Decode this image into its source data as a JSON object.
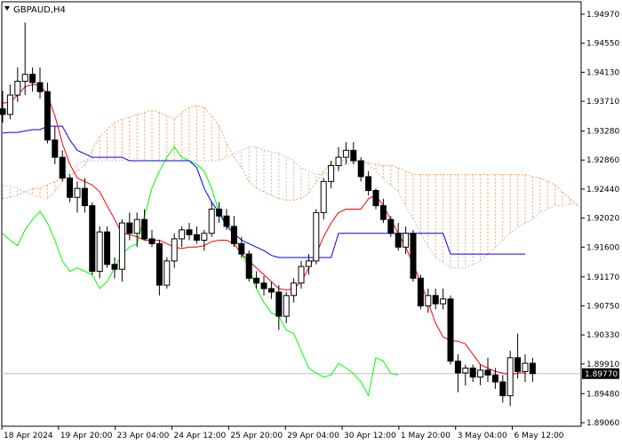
{
  "chart_data": {
    "type": "candlestick",
    "title": "GBPAUD,H4",
    "y_ticks": [
      "1.94970",
      "1.94550",
      "1.94130",
      "1.93710",
      "1.93280",
      "1.92860",
      "1.92440",
      "1.92020",
      "1.91600",
      "1.91170",
      "1.90750",
      "1.90330",
      "1.89910",
      "1.89480",
      "1.89060"
    ],
    "ylim": [
      1.8906,
      1.9497
    ],
    "x_ticks": [
      "18 Apr 2024",
      "19 Apr 20:00",
      "23 Apr 04:00",
      "24 Apr 12:00",
      "25 Apr 20:00",
      "29 Apr 04:00",
      "30 Apr 12:00",
      "1 May 20:00",
      "3 May 04:00",
      "6 May 12:00"
    ],
    "current_price": "1.89770",
    "grid": false,
    "colors": {
      "tenkan": "#ff0000",
      "kijun": "#0000ff",
      "chikou": "#00ff00",
      "cloud": "#f4a460",
      "cloud_alt": "#c0c0c0",
      "candle": "#000000",
      "price_line": "#c0c0c0"
    },
    "candles": [
      [
        1.936,
        1.9386,
        1.934,
        1.9352
      ],
      [
        1.9352,
        1.9395,
        1.9345,
        1.938
      ],
      [
        1.938,
        1.942,
        1.937,
        1.94
      ],
      [
        1.94,
        1.9485,
        1.938,
        1.941
      ],
      [
        1.941,
        1.942,
        1.9385,
        1.9398
      ],
      [
        1.9398,
        1.942,
        1.9375,
        1.9385
      ],
      [
        1.9385,
        1.9398,
        1.931,
        1.9315
      ],
      [
        1.9315,
        1.9335,
        1.928,
        1.929
      ],
      [
        1.929,
        1.93,
        1.9255,
        1.926
      ],
      [
        1.926,
        1.9265,
        1.9225,
        1.9232
      ],
      [
        1.9232,
        1.9255,
        1.921,
        1.9245
      ],
      [
        1.9245,
        1.926,
        1.921,
        1.922
      ],
      [
        1.922,
        1.9225,
        1.912,
        1.9125
      ],
      [
        1.9125,
        1.919,
        1.9115,
        1.9182
      ],
      [
        1.9182,
        1.919,
        1.913,
        1.9135
      ],
      [
        1.9135,
        1.9145,
        1.9115,
        1.9128
      ],
      [
        1.9128,
        1.92,
        1.911,
        1.9195
      ],
      [
        1.9195,
        1.921,
        1.917,
        1.918
      ],
      [
        1.918,
        1.921,
        1.916,
        1.92
      ],
      [
        1.92,
        1.9215,
        1.917,
        1.9172
      ],
      [
        1.9172,
        1.9185,
        1.916,
        1.9165
      ],
      [
        1.9165,
        1.917,
        1.909,
        1.9105
      ],
      [
        1.9105,
        1.9145,
        1.91,
        1.914
      ],
      [
        1.914,
        1.918,
        1.913,
        1.9172
      ],
      [
        1.9172,
        1.919,
        1.916,
        1.9185
      ],
      [
        1.9185,
        1.9195,
        1.917,
        1.9178
      ],
      [
        1.9178,
        1.919,
        1.9165,
        1.917
      ],
      [
        1.917,
        1.9185,
        1.9155,
        1.918
      ],
      [
        1.918,
        1.9225,
        1.9175,
        1.9215
      ],
      [
        1.9215,
        1.9225,
        1.9195,
        1.9205
      ],
      [
        1.9205,
        1.9215,
        1.9185,
        1.919
      ],
      [
        1.919,
        1.9205,
        1.916,
        1.9165
      ],
      [
        1.9165,
        1.9175,
        1.9145,
        1.915
      ],
      [
        1.915,
        1.9155,
        1.911,
        1.9115
      ],
      [
        1.9115,
        1.9125,
        1.91,
        1.9108
      ],
      [
        1.9108,
        1.9118,
        1.909,
        1.91
      ],
      [
        1.91,
        1.911,
        1.9085,
        1.9095
      ],
      [
        1.9095,
        1.9105,
        1.904,
        1.906
      ],
      [
        1.906,
        1.9095,
        1.905,
        1.909
      ],
      [
        1.909,
        1.9115,
        1.908,
        1.9108
      ],
      [
        1.9108,
        1.914,
        1.91,
        1.9132
      ],
      [
        1.9132,
        1.915,
        1.912,
        1.914
      ],
      [
        1.914,
        1.9215,
        1.9135,
        1.921
      ],
      [
        1.921,
        1.926,
        1.92,
        1.9255
      ],
      [
        1.9255,
        1.9285,
        1.9245,
        1.9278
      ],
      [
        1.9278,
        1.9305,
        1.927,
        1.929
      ],
      [
        1.929,
        1.9312,
        1.928,
        1.93
      ],
      [
        1.93,
        1.9312,
        1.928,
        1.9285
      ],
      [
        1.9285,
        1.929,
        1.9255,
        1.9262
      ],
      [
        1.9262,
        1.927,
        1.9235,
        1.9242
      ],
      [
        1.9242,
        1.9245,
        1.9215,
        1.922
      ],
      [
        1.922,
        1.923,
        1.9195,
        1.92
      ],
      [
        1.92,
        1.9205,
        1.9175,
        1.918
      ],
      [
        1.918,
        1.9195,
        1.9155,
        1.916
      ],
      [
        1.916,
        1.919,
        1.915,
        1.918
      ],
      [
        1.918,
        1.9185,
        1.911,
        1.9115
      ],
      [
        1.9115,
        1.912,
        1.907,
        1.9075
      ],
      [
        1.9075,
        1.91,
        1.9065,
        1.909
      ],
      [
        1.909,
        1.91,
        1.907,
        1.9078
      ],
      [
        1.9078,
        1.91,
        1.907,
        1.9085
      ],
      [
        1.9085,
        1.909,
        1.899,
        1.8995
      ],
      [
        1.8995,
        1.9005,
        1.895,
        1.8978
      ],
      [
        1.8978,
        1.899,
        1.896,
        1.8985
      ],
      [
        1.8985,
        1.899,
        1.8965,
        1.8972
      ],
      [
        1.8972,
        1.899,
        1.896,
        1.8982
      ],
      [
        1.8982,
        1.9,
        1.8965,
        1.8975
      ],
      [
        1.8975,
        1.8985,
        1.8955,
        1.8965
      ],
      [
        1.8965,
        1.8975,
        1.8935,
        1.8945
      ],
      [
        1.8945,
        1.901,
        1.893,
        1.9
      ],
      [
        1.9,
        1.9035,
        1.897,
        1.898
      ],
      [
        1.898,
        1.9005,
        1.8965,
        1.8992
      ],
      [
        1.8992,
        1.9,
        1.8965,
        1.8977
      ]
    ],
    "tenkan": [
      1.9368,
      1.937,
      1.938,
      1.9392,
      1.9395,
      1.9395,
      1.938,
      1.935,
      1.931,
      1.928,
      1.926,
      1.9255,
      1.925,
      1.924,
      1.922,
      1.92,
      1.918,
      1.9178,
      1.9175,
      1.917,
      1.917,
      1.917,
      1.9165,
      1.916,
      1.9158,
      1.916,
      1.916,
      1.9162,
      1.9168,
      1.917,
      1.917,
      1.9165,
      1.915,
      1.914,
      1.913,
      1.912,
      1.911,
      1.91,
      1.9098,
      1.91,
      1.911,
      1.913,
      1.915,
      1.9175,
      1.9195,
      1.921,
      1.9215,
      1.9215,
      1.9215,
      1.923,
      1.9235,
      1.922,
      1.92,
      1.918,
      1.916,
      1.9135,
      1.911,
      1.908,
      1.905,
      1.903,
      1.9025,
      1.9024,
      1.902,
      1.9005,
      1.899,
      1.8985,
      1.898,
      1.8978,
      1.8975,
      1.8978,
      1.8978
    ],
    "kijun": [
      1.9325,
      1.9326,
      1.9326,
      1.9328,
      1.933,
      1.933,
      1.9335,
      1.9335,
      1.9335,
      1.9315,
      1.93,
      1.9295,
      1.929,
      1.929,
      1.929,
      1.929,
      1.929,
      1.9285,
      1.9285,
      1.9285,
      1.9285,
      1.9285,
      1.9285,
      1.9285,
      1.9285,
      1.9285,
      1.9275,
      1.9245,
      1.9225,
      1.921,
      1.919,
      1.918,
      1.917,
      1.9165,
      1.916,
      1.9155,
      1.9148,
      1.9145,
      1.9145,
      1.9145,
      1.9145,
      1.9145,
      1.9145,
      1.9145,
      1.9145,
      1.918,
      1.918,
      1.918,
      1.918,
      1.918,
      1.918,
      1.918,
      1.918,
      1.918,
      1.918,
      1.918,
      1.918,
      1.918,
      1.918,
      1.918,
      1.915,
      1.915,
      1.915,
      1.915,
      1.915,
      1.915,
      1.915,
      1.915,
      1.915,
      1.915,
      1.915
    ],
    "chikou": [
      1.918,
      1.917,
      1.9162,
      1.9185,
      1.92,
      1.9212,
      1.9195,
      1.917,
      1.914,
      1.9125,
      1.913,
      1.9125,
      1.912,
      1.91,
      1.911,
      1.913,
      1.915,
      1.916,
      1.9165,
      1.9205,
      1.9245,
      1.927,
      1.929,
      1.9305,
      1.929,
      1.9285,
      1.928,
      1.927,
      1.9245,
      1.921,
      1.9195,
      1.918,
      1.915,
      1.913,
      1.91,
      1.908,
      1.9065,
      1.906,
      1.904,
      1.9035,
      1.901,
      1.8985,
      1.8978,
      1.8972,
      1.8975,
      1.8992,
      1.8985,
      1.8977,
      1.8965,
      1.8945,
      1.9,
      1.8995,
      1.8977,
      1.8975
    ],
    "cloud_a": [
      1.923,
      1.9232,
      1.9235,
      1.924,
      1.9245,
      1.9245,
      1.925,
      1.9255,
      1.926,
      1.9265,
      1.927,
      1.9278,
      1.93,
      1.932,
      1.933,
      1.934,
      1.9345,
      1.9348,
      1.9352,
      1.9355,
      1.9358,
      1.9355,
      1.935,
      1.9345,
      1.9355,
      1.9362,
      1.9365,
      1.9362,
      1.935,
      1.9335,
      1.931,
      1.929,
      1.9275,
      1.9255,
      1.9245,
      1.924,
      1.9235,
      1.923,
      1.9228,
      1.9228,
      1.923,
      1.9238,
      1.9255,
      1.927,
      1.9282,
      1.9285,
      1.9285,
      1.9285,
      1.9285,
      1.9282,
      1.928,
      1.9278,
      1.9278,
      1.9275,
      1.927,
      1.9265,
      1.9265,
      1.9265,
      1.9265,
      1.9265,
      1.9265,
      1.9265,
      1.9265,
      1.9265,
      1.9265,
      1.9265,
      1.9265,
      1.9265,
      1.9265,
      1.9265,
      1.9265,
      1.9262,
      1.926,
      1.9255,
      1.925,
      1.924,
      1.923,
      1.922
    ],
    "cloud_b": [
      1.925,
      1.9248,
      1.9245,
      1.924,
      1.9235,
      1.9232,
      1.923,
      1.924,
      1.9255,
      1.927,
      1.928,
      1.9285,
      1.9285,
      1.9285,
      1.9285,
      1.9285,
      1.9285,
      1.9285,
      1.9285,
      1.9285,
      1.9285,
      1.9285,
      1.9285,
      1.9285,
      1.9285,
      1.9285,
      1.9285,
      1.9285,
      1.9285,
      1.9285,
      1.929,
      1.9295,
      1.93,
      1.9305,
      1.9305,
      1.93,
      1.9298,
      1.9296,
      1.929,
      1.9285,
      1.9275,
      1.927,
      1.9265,
      1.9265,
      1.927,
      1.9275,
      1.928,
      1.9282,
      1.9285,
      1.928,
      1.927,
      1.926,
      1.925,
      1.924,
      1.922,
      1.92,
      1.918,
      1.916,
      1.9145,
      1.9138,
      1.913,
      1.913,
      1.913,
      1.9135,
      1.914,
      1.915,
      1.916,
      1.917,
      1.918,
      1.9188,
      1.9195,
      1.92,
      1.921,
      1.9215,
      1.922,
      1.922,
      1.9222,
      1.9222
    ]
  }
}
